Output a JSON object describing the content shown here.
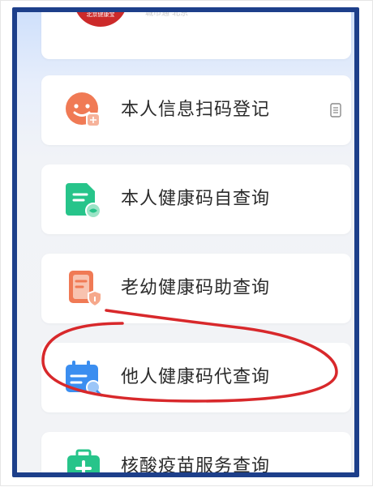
{
  "top_card": {
    "seal_text": "北京健康宝",
    "faint_text": "城市通 北京"
  },
  "menu": {
    "items": [
      {
        "label": "本人信息扫码登记",
        "icon": "smile-scan-icon"
      },
      {
        "label": "本人健康码自查询",
        "icon": "health-doc-icon"
      },
      {
        "label": "老幼健康码助查询",
        "icon": "elder-child-doc-icon"
      },
      {
        "label": "他人健康码代查询",
        "icon": "calendar-search-icon"
      },
      {
        "label": "核酸疫苗服务查询",
        "icon": "medical-kit-icon"
      }
    ]
  },
  "colors": {
    "frame_border": "#1d3f8a",
    "annotation_circle": "#d8282b",
    "orange_icon": "#f07a55",
    "green_icon": "#27c48a",
    "blue_icon": "#3b8ef0"
  }
}
